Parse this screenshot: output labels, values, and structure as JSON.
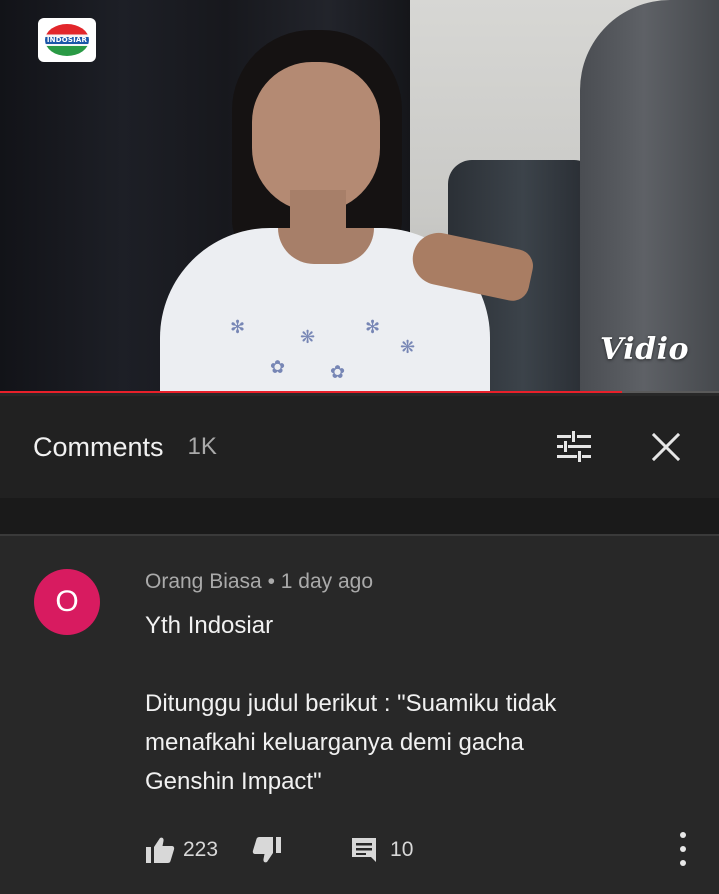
{
  "video": {
    "channel_logo_text": "INDOSIAR",
    "watermark": "Vidio",
    "progress": 0.865
  },
  "comments_header": {
    "title": "Comments",
    "count": "1K",
    "sort_icon": "sort-filter-icon",
    "close_icon": "close-icon"
  },
  "comment": {
    "avatar_letter": "O",
    "avatar_color": "#d81b60",
    "meta": "Orang Biasa • 1 day ago",
    "line1": "Yth Indosiar",
    "line2": "Ditunggu judul berikut : \"Suamiku tidak",
    "line3": "menafkahi keluarganya demi gacha",
    "line4": "Genshin Impact\"",
    "likes": "223",
    "replies": "10",
    "like_icon": "thumbs-up-icon",
    "dislike_icon": "thumbs-down-icon",
    "reply_icon": "comment-icon",
    "more_icon": "more-vertical-icon"
  },
  "colors": {
    "background": "#282828",
    "header_bg": "#212121",
    "progress": "#e8202a",
    "text_primary": "#f1f1f1",
    "text_secondary": "#aaaaaa"
  }
}
